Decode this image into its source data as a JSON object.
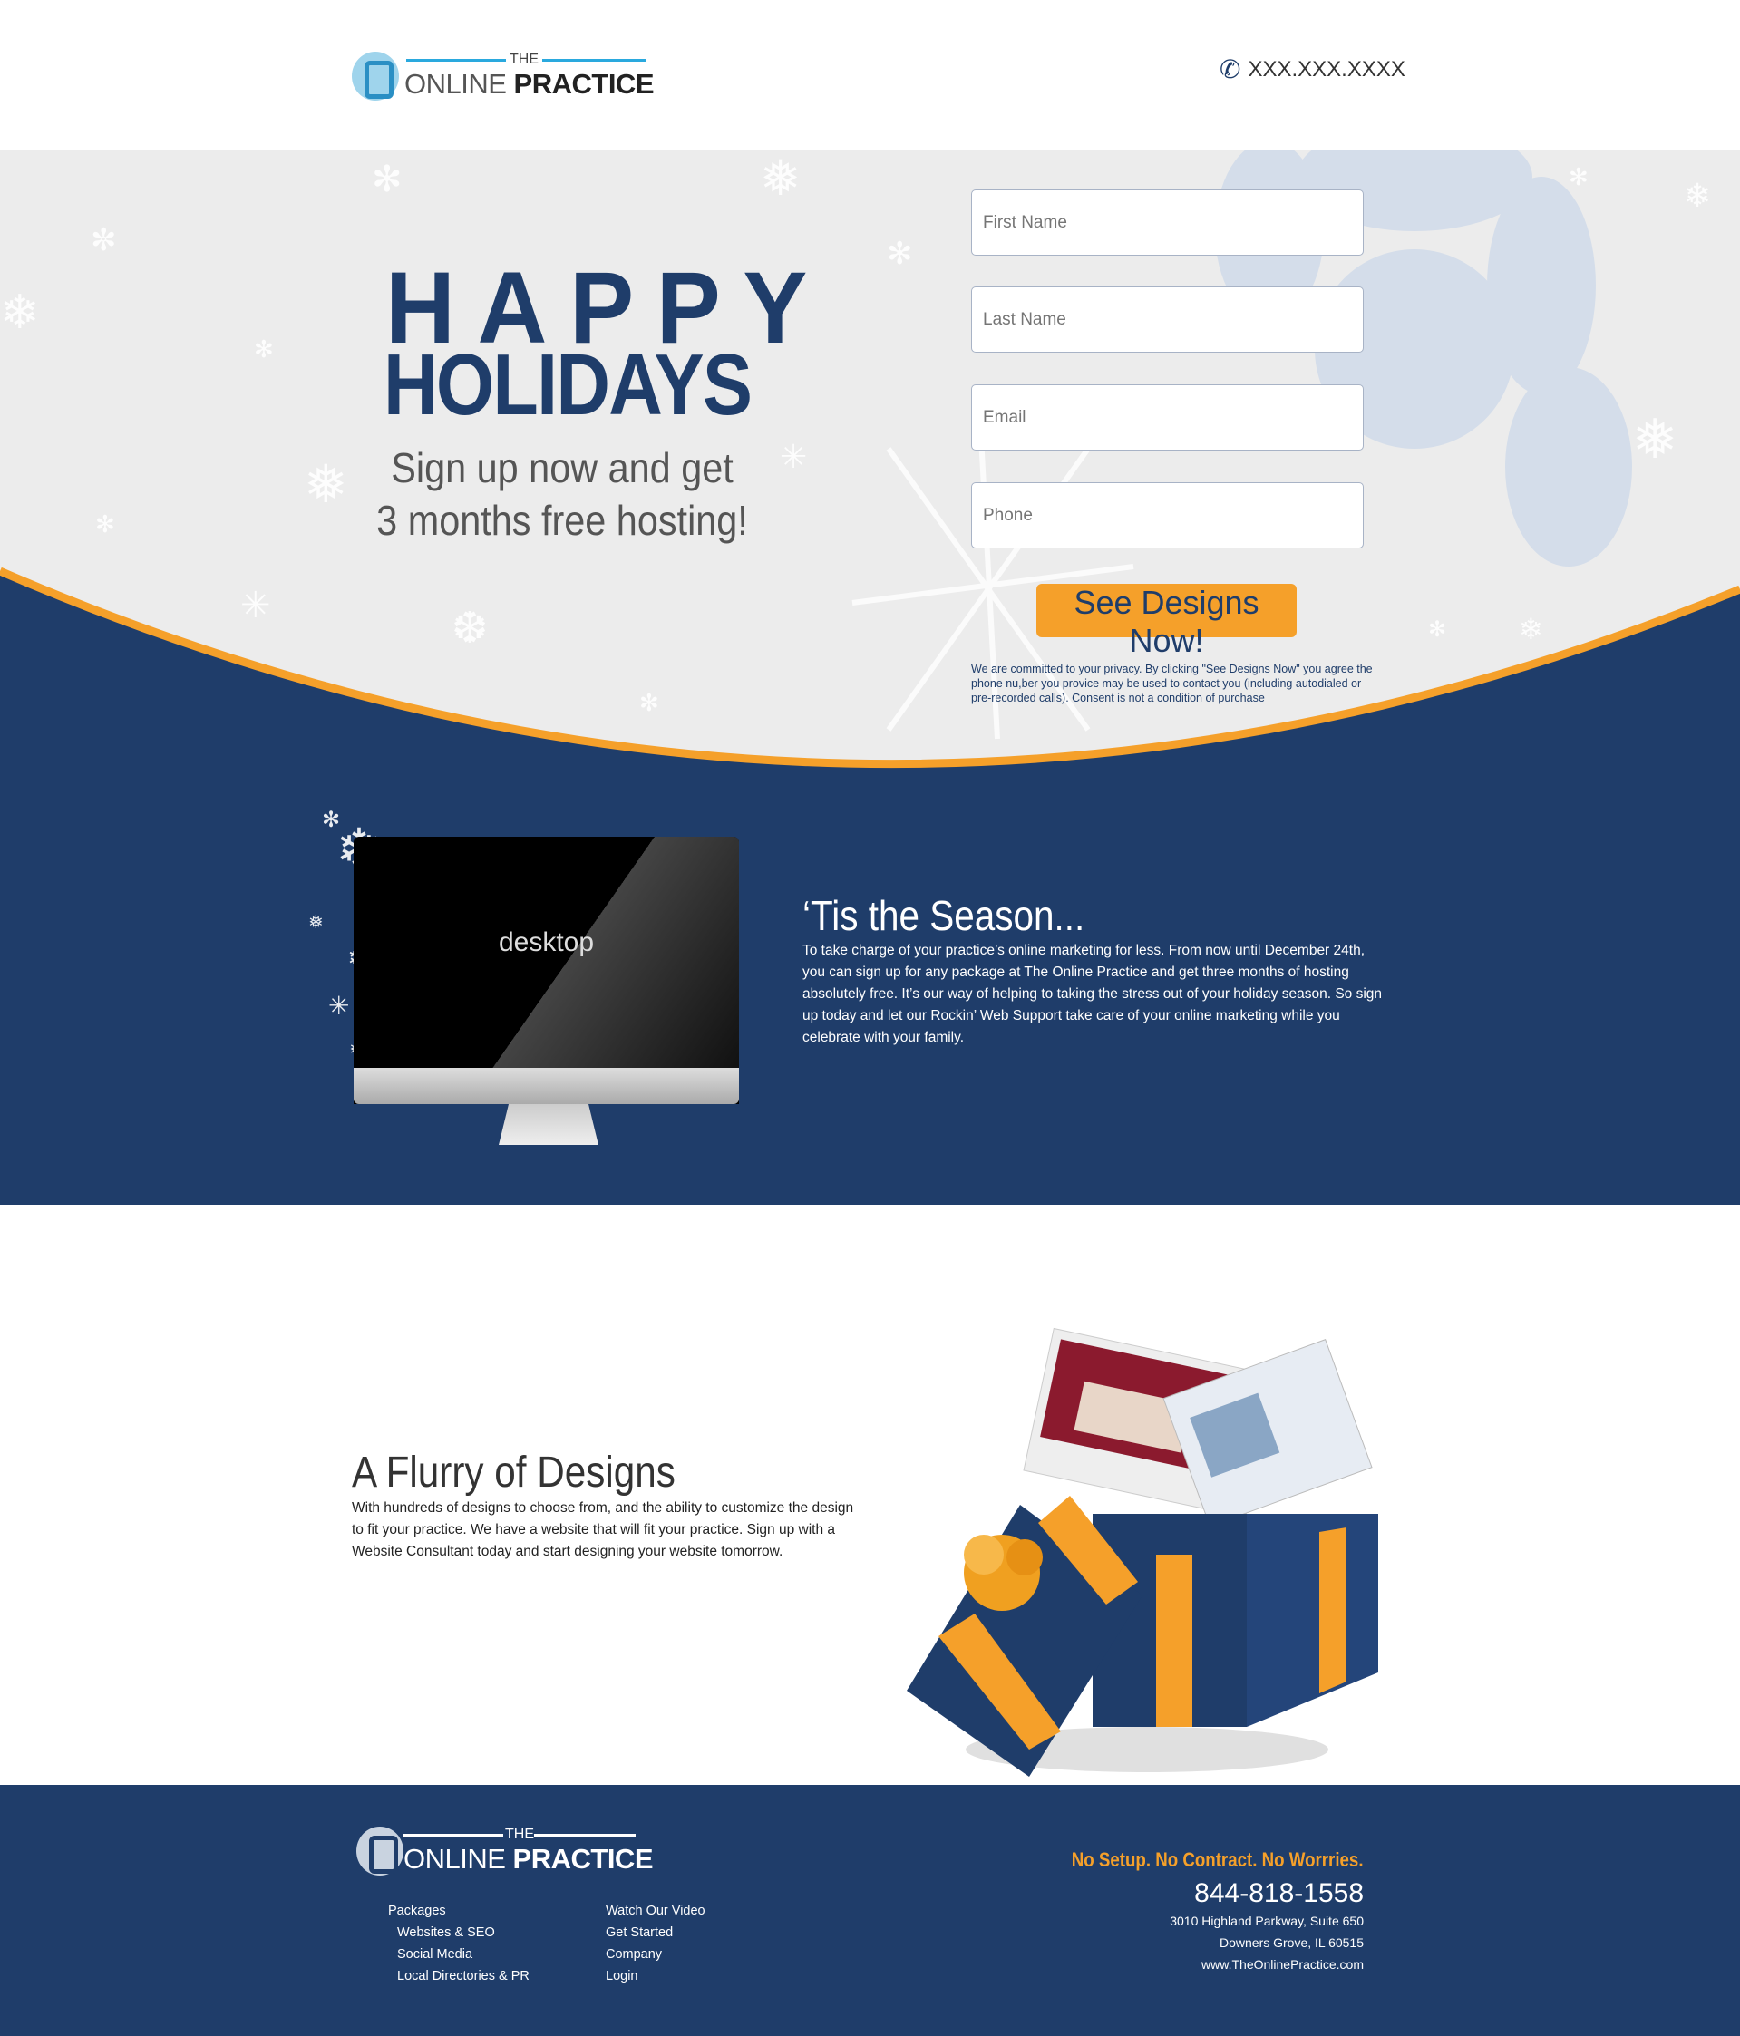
{
  "header": {
    "logo": {
      "the": "THE",
      "online": "ONLINE",
      "practice": "PRACTICE"
    },
    "phone": "XXX.XXX.XXXX",
    "phone_icon": "phone-icon"
  },
  "hero": {
    "title_line1": "HAPPY",
    "title_line2": "HOLIDAYS",
    "subtitle_line1": "Sign up now and get",
    "subtitle_line2": "3 months free hosting!",
    "form": {
      "first_name_placeholder": "First Name",
      "last_name_placeholder": "Last Name",
      "email_placeholder": "Email",
      "phone_placeholder": "Phone",
      "submit_label": "See Designs Now!",
      "privacy": "We are committed to your privacy. By clicking \"See Designs Now\" you agree the phone nu,ber you provice may be used to contact you (including autodialed or pre-recorded calls). Consent is not a condition of purchase"
    }
  },
  "season": {
    "monitor_label": "desktop",
    "title": "‘Tis the Season...",
    "body": "To take charge of your practice’s online marketing for less. From now until December 24th, you can sign up for any package at The Online Practice and get three months of hosting absolutely free. It’s our way of helping to taking the stress out of your holiday season. So sign up today and let our Rockin’ Web Support take care of your online marketing while you celebrate with your family."
  },
  "flurry": {
    "title": "A Flurry of Designs",
    "body": "With hundreds of designs to choose from, and the ability to customize the design to fit your practice. We have a website that will fit your practice. Sign up with a Website Consultant today and start designing your website tomorrow."
  },
  "footer": {
    "logo": {
      "the": "THE",
      "online": "ONLINE",
      "practice": "PRACTICE"
    },
    "links_col1": [
      "Packages",
      "Websites & SEO",
      "Social Media",
      "Local Directories & PR"
    ],
    "links_col2": [
      "Watch Our Video",
      "Get Started",
      "Company",
      "Login"
    ],
    "tagline": "No Setup. No Contract. No Worrries.",
    "phone": "844-818-1558",
    "address1": "3010 Highland Parkway, Suite 650",
    "address2": "Downers Grove, IL 60515",
    "website": "www.TheOnlinePractice.com"
  },
  "colors": {
    "navy": "#1f3d6a",
    "orange": "#f5a02a",
    "hero_bg": "#ececec"
  }
}
